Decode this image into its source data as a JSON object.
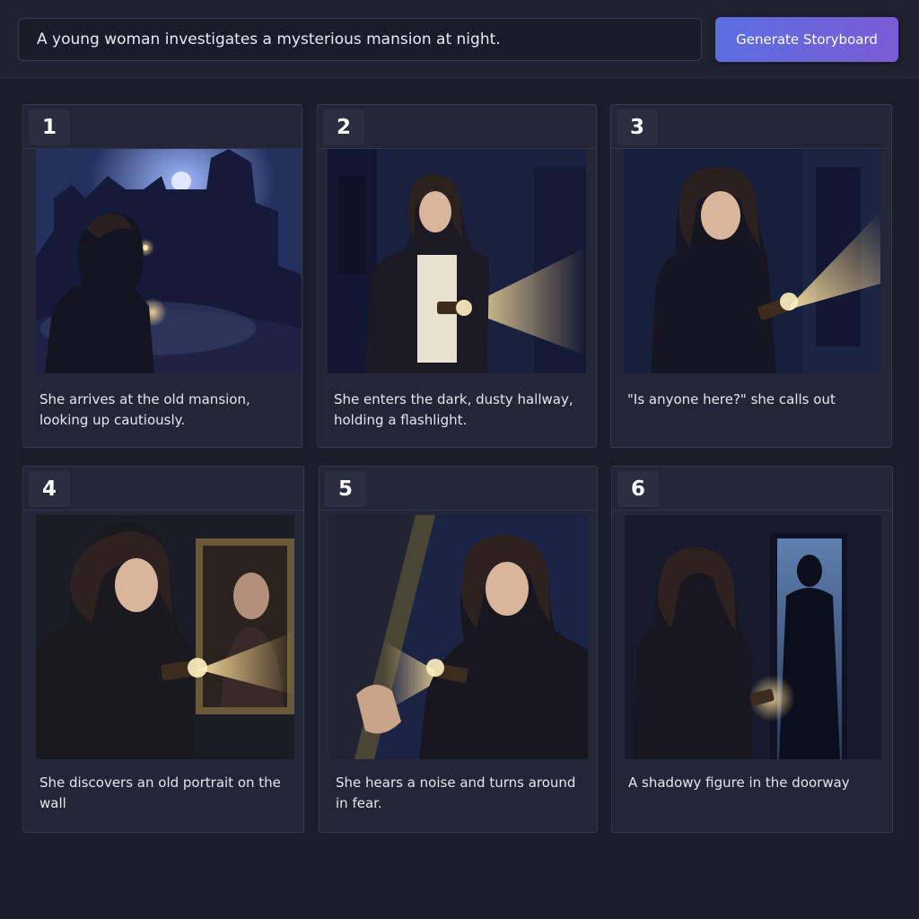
{
  "prompt": {
    "value": "A young woman investigates a mysterious mansion at night."
  },
  "generate_button": {
    "label": "Generate Storyboard"
  },
  "panels": [
    {
      "number": "1",
      "caption": "She arrives at the old mansion, looking up cautiously."
    },
    {
      "number": "2",
      "caption": "She enters the dark, dusty hallway, holding a flashlight."
    },
    {
      "number": "3",
      "caption": "\"Is anyone here?\" she calls out"
    },
    {
      "number": "4",
      "caption": "She discovers an old portrait on the wall"
    },
    {
      "number": "5",
      "caption": "She hears a noise and turns around in fear."
    },
    {
      "number": "6",
      "caption": "A shadowy figure in the doorway"
    }
  ],
  "colors": {
    "background": "#1b1d2a",
    "panel": "#232636",
    "accent_start": "#5b6ee0",
    "accent_end": "#7a5cd6",
    "flashlight_glow": "#ffd98a"
  }
}
